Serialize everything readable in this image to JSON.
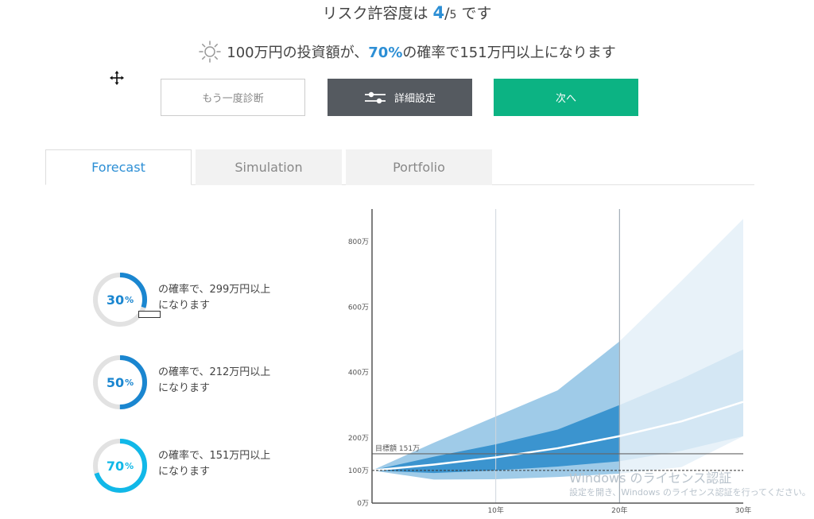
{
  "header": {
    "risk_prefix": "リスク許容度は",
    "risk_num": "4",
    "risk_slash": "/",
    "risk_den": "5",
    "risk_suffix": "です",
    "prob_prefix": "100万円の投資額が、",
    "prob_pct": "70%",
    "prob_suffix": "の確率で151万円以上になります",
    "sun_icon": "sun-icon"
  },
  "buttons": {
    "retry": "もう一度診断",
    "detail": "詳細設定",
    "next": "次へ"
  },
  "tabs": [
    {
      "label": "Forecast",
      "active": true
    },
    {
      "label": "Simulation",
      "active": false
    },
    {
      "label": "Portfolio",
      "active": false
    }
  ],
  "rings": [
    {
      "value": "30",
      "unit": "%",
      "fraction": 0.3,
      "color": "#1a86d0",
      "line1": "の確率で、299万円以上",
      "line2": "になります"
    },
    {
      "value": "50",
      "unit": "%",
      "fraction": 0.5,
      "color": "#1a86d0",
      "line1": "の確率で、212万円以上",
      "line2": "になります"
    },
    {
      "value": "70",
      "unit": "%",
      "fraction": 0.7,
      "color": "#11b8e8",
      "line1": "の確率で、151万円以上",
      "line2": "になります"
    }
  ],
  "chart_data": {
    "type": "area",
    "y_ticks": [
      {
        "value": 0,
        "label": "0万"
      },
      {
        "value": 100,
        "label": "100万"
      },
      {
        "value": 200,
        "label": "200万"
      },
      {
        "value": 400,
        "label": "400万"
      },
      {
        "value": 600,
        "label": "600万"
      },
      {
        "value": 800,
        "label": "800万"
      }
    ],
    "x_ticks": [
      {
        "value": 10,
        "label": "10年"
      },
      {
        "value": 20,
        "label": "20年"
      },
      {
        "value": 30,
        "label": "30年"
      }
    ],
    "xlim": [
      0,
      30
    ],
    "ylim": [
      0,
      900
    ],
    "target": {
      "value": 151,
      "label": "目標額 151万"
    },
    "baseline": 100,
    "highlight_until": 20,
    "x": [
      0,
      5,
      10,
      15,
      20,
      25,
      30
    ],
    "series": [
      {
        "outer_upper": [
          100,
          185,
          265,
          345,
          495,
          680,
          870
        ]
      },
      {
        "outer_lower": [
          100,
          72,
          73,
          80,
          90,
          110,
          205
        ]
      },
      {
        "inner_upper": [
          100,
          142,
          180,
          225,
          300,
          380,
          470
        ]
      },
      {
        "inner_lower": [
          100,
          92,
          100,
          112,
          128,
          160,
          205
        ]
      },
      {
        "median": [
          100,
          118,
          140,
          168,
          205,
          250,
          310
        ]
      }
    ],
    "colors": {
      "outer": "#9fcbe8",
      "inner": "#3b94cf",
      "outer_faded": "#e8f2f9",
      "inner_faded": "#d4e7f4",
      "median": "#ffffff"
    }
  },
  "watermark": {
    "line1": "Windows のライセンス認証",
    "line2": "設定を開き、Windows のライセンス認証を行ってください。"
  }
}
